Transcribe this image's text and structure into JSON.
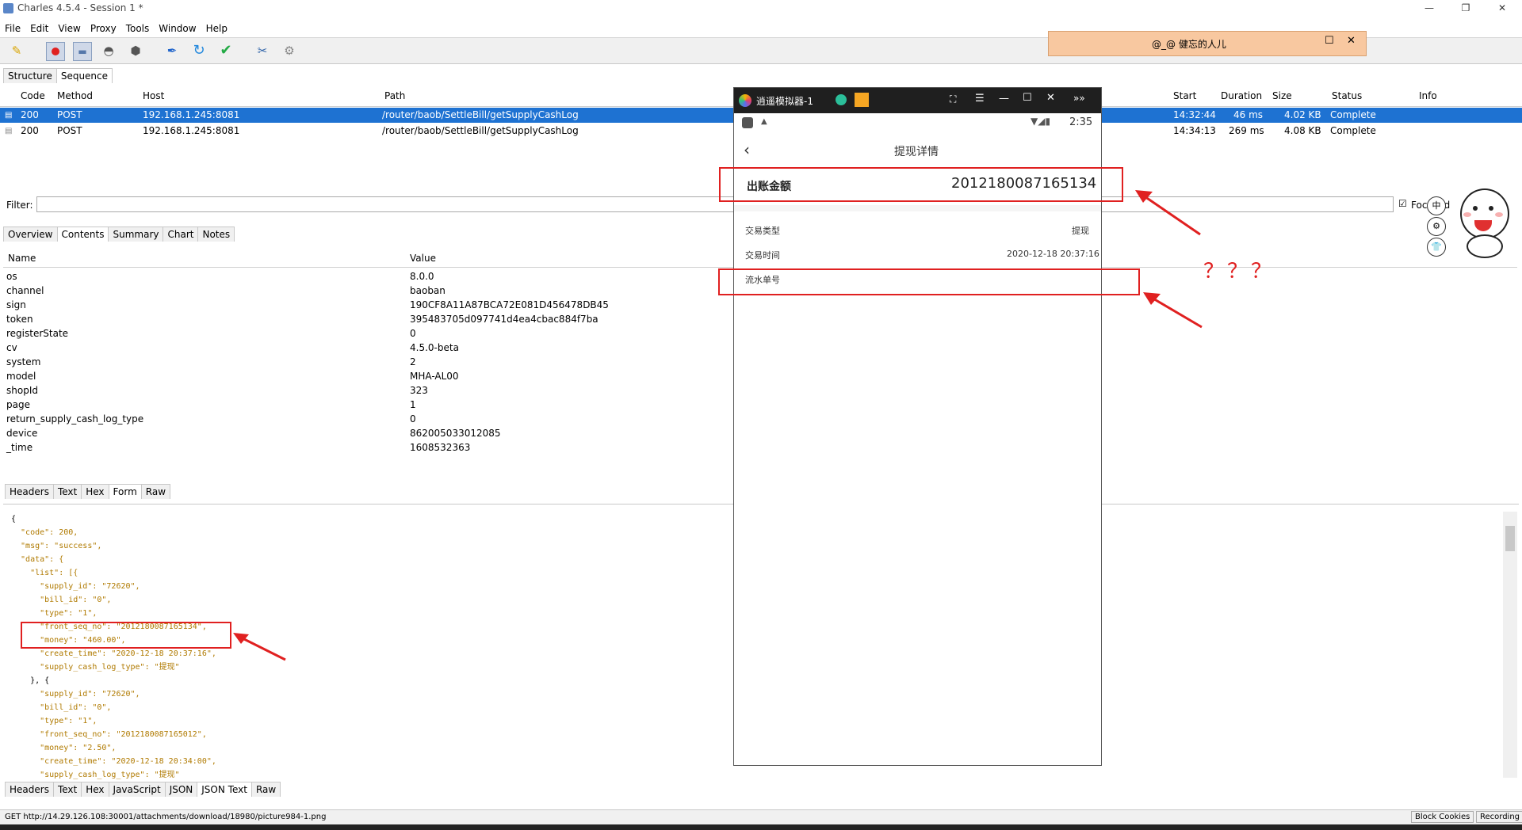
{
  "window": {
    "title": "Charles 4.5.4 - Session 1 *",
    "controls": {
      "minimize": "—",
      "restore": "❐",
      "close": "✕"
    }
  },
  "menu": [
    "File",
    "Edit",
    "View",
    "Proxy",
    "Tools",
    "Window",
    "Help"
  ],
  "toolbar_icons": [
    "broom-icon",
    "record-icon",
    "throttle-icon",
    "turtle-icon",
    "stop-icon",
    "pen-icon",
    "refresh-icon",
    "check-icon",
    "tools-icon",
    "settings-icon"
  ],
  "notification": {
    "text": "@_@   健忘的人儿"
  },
  "view_tabs": [
    "Structure",
    "Sequence"
  ],
  "table": {
    "columns": [
      "Code",
      "Method",
      "Host",
      "Path",
      "Start",
      "Duration",
      "Size",
      "Status",
      "Info"
    ],
    "rows": [
      {
        "code": "200",
        "method": "POST",
        "host": "192.168.1.245:8081",
        "path": "/router/baob/SettleBill/getSupplyCashLog",
        "start": "14:32:44",
        "duration": "46 ms",
        "size": "4.02 KB",
        "status": "Complete",
        "info": ""
      },
      {
        "code": "200",
        "method": "POST",
        "host": "192.168.1.245:8081",
        "path": "/router/baob/SettleBill/getSupplyCashLog",
        "start": "14:34:13",
        "duration": "269 ms",
        "size": "4.08 KB",
        "status": "Complete",
        "info": ""
      }
    ]
  },
  "filter": {
    "label": "Filter:",
    "value": "",
    "focused_label": "Focused"
  },
  "detail_tabs": [
    "Overview",
    "Contents",
    "Summary",
    "Chart",
    "Notes"
  ],
  "form": {
    "headers": [
      "Name",
      "Value"
    ],
    "rows": [
      [
        "os",
        "8.0.0"
      ],
      [
        "channel",
        "baoban"
      ],
      [
        "sign",
        "190CF8A11A87BCA72E081D456478DB45"
      ],
      [
        "token",
        "395483705d097741d4ea4cbac884f7ba"
      ],
      [
        "registerState",
        "0"
      ],
      [
        "cv",
        "4.5.0-beta"
      ],
      [
        "system",
        "2"
      ],
      [
        "model",
        "MHA-AL00"
      ],
      [
        "shopId",
        "323"
      ],
      [
        "page",
        "1"
      ],
      [
        "return_supply_cash_log_type",
        "0"
      ],
      [
        "device",
        "862005033012085"
      ],
      [
        "_time",
        "1608532363"
      ]
    ]
  },
  "request_tabs": [
    "Headers",
    "Text",
    "Hex",
    "Form",
    "Raw"
  ],
  "response_tabs": [
    "Headers",
    "Text",
    "Hex",
    "JavaScript",
    "JSON",
    "JSON Text",
    "Raw"
  ],
  "json_lines": [
    "{",
    "  \"code\": 200,",
    "  \"msg\": \"success\",",
    "  \"data\": {",
    "    \"list\": [{",
    "      \"supply_id\": \"72620\",",
    "      \"bill_id\": \"0\",",
    "      \"type\": \"1\",",
    "      \"front_seq_no\": \"2012180087165134\",",
    "      \"money\": \"460.00\",",
    "      \"create_time\": \"2020-12-18 20:37:16\",",
    "      \"supply_cash_log_type\": \"提现\"",
    "    }, {",
    "      \"supply_id\": \"72620\",",
    "      \"bill_id\": \"0\",",
    "      \"type\": \"1\",",
    "      \"front_seq_no\": \"2012180087165012\",",
    "      \"money\": \"2.50\",",
    "      \"create_time\": \"2020-12-18 20:34:00\",",
    "      \"supply_cash_log_type\": \"提现\""
  ],
  "statusbar": {
    "text": "GET http://14.29.126.108:30001/attachments/download/18980/picture984-1.png",
    "block_cookies": "Block Cookies",
    "recording": "Recording"
  },
  "emulator": {
    "title": "逍遥模拟器-1",
    "time": "2:35",
    "page_title": "提现详情",
    "amount_label": "出账金额",
    "amount_value": "2012180087165134",
    "rows": [
      {
        "label": "交易类型",
        "value": "提现"
      },
      {
        "label": "交易时间",
        "value": "2020-12-18 20:37:16"
      },
      {
        "label": "流水单号",
        "value": ""
      }
    ]
  },
  "annotation": {
    "question_marks": "？？？"
  },
  "accent": {
    "selection": "#1e72d2",
    "annotation_red": "#e02020"
  }
}
